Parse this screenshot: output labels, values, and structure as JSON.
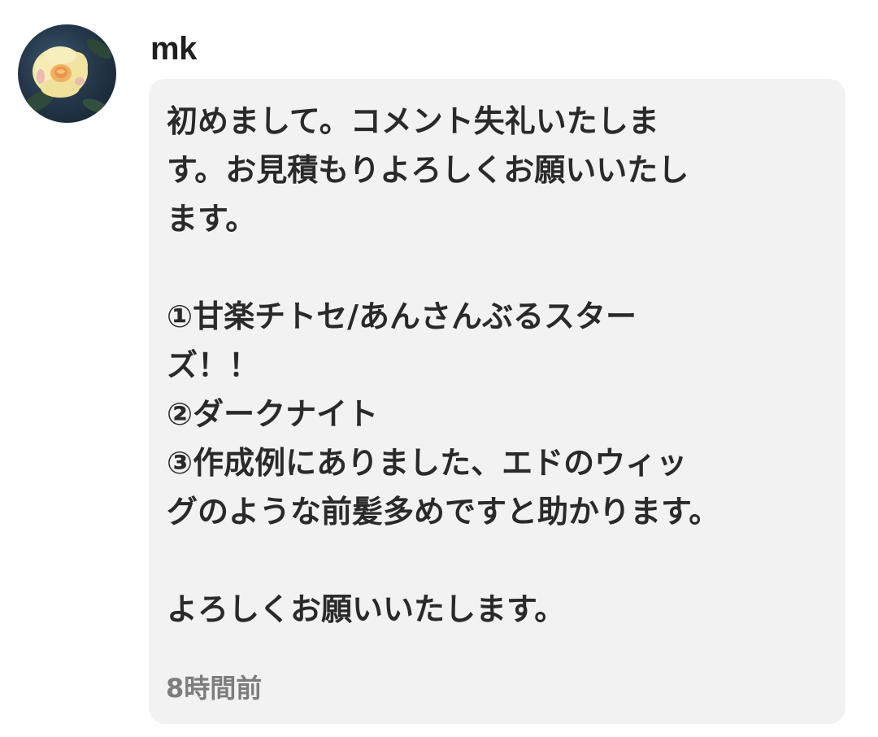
{
  "comment": {
    "author": "mk",
    "avatar_icon": "yellow-rose-icon",
    "lines": [
      "初めまして。コメント失礼いたしま",
      "す。お見積もりよろしくお願いいたし",
      "ます。",
      "",
      "①甘楽チトセ/あんさんぶるスター",
      "ズ！！",
      "②ダークナイト",
      "③作成例にありました、エドのウィッ",
      "グのような前髪多めですと助かります。",
      "",
      "よろしくお願いいたします。"
    ],
    "timestamp": "8時間前"
  },
  "colors": {
    "bubble_background": "#f2f2f2",
    "text": "#2a2a2a",
    "timestamp": "#7d7d7d"
  }
}
